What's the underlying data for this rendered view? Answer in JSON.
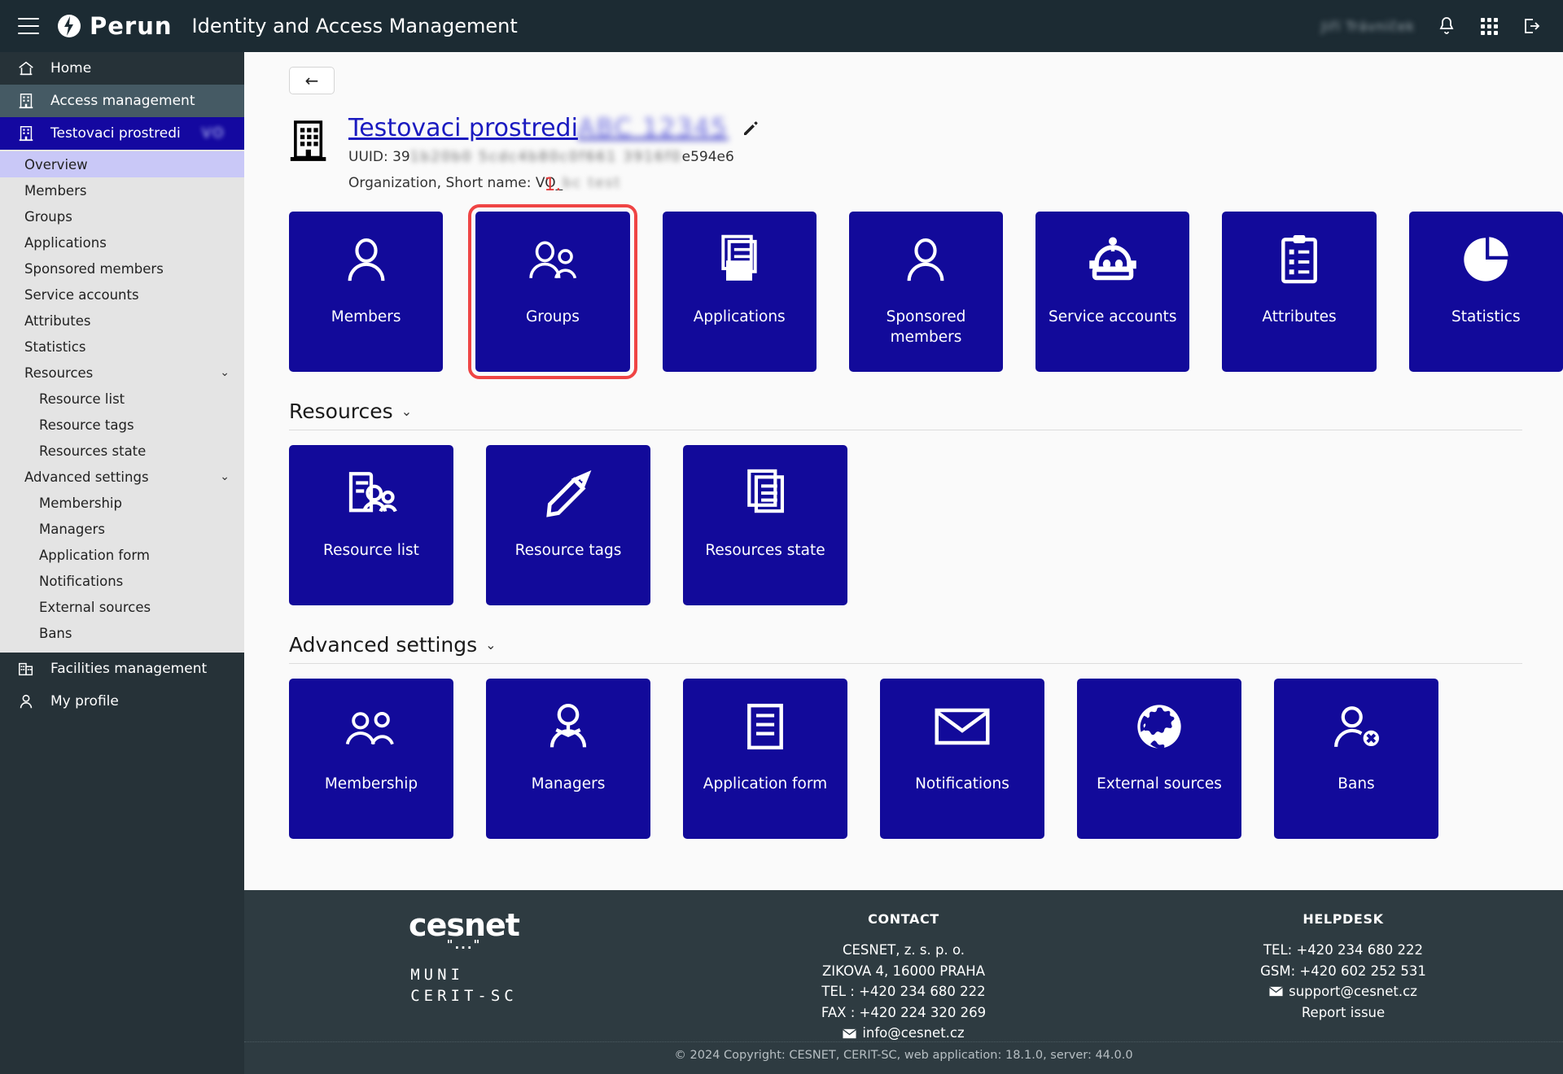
{
  "topbar": {
    "app_name": "Perun",
    "app_title": "Identity and Access Management",
    "user_blurred": "Jiří Trávníček",
    "icons": {
      "menu": "hamburger-icon",
      "notifications": "bell-icon",
      "apps": "apps-grid-icon",
      "logout": "logout-icon"
    }
  },
  "sidebar": {
    "top_items": [
      {
        "label": "Home",
        "icon": "home-icon",
        "state": "normal"
      },
      {
        "label": "Access management",
        "icon": "building-icon",
        "state": "hover"
      },
      {
        "label": "Testovaci prostredi",
        "icon": "building-icon",
        "state": "active",
        "blurred_suffix": "VO"
      }
    ],
    "sub_items": [
      {
        "label": "Overview",
        "selected": true,
        "indent": false
      },
      {
        "label": "Members",
        "selected": false,
        "indent": false
      },
      {
        "label": "Groups",
        "selected": false,
        "indent": false
      },
      {
        "label": "Applications",
        "selected": false,
        "indent": false
      },
      {
        "label": "Sponsored members",
        "selected": false,
        "indent": false
      },
      {
        "label": "Service accounts",
        "selected": false,
        "indent": false
      },
      {
        "label": "Attributes",
        "selected": false,
        "indent": false
      },
      {
        "label": "Statistics",
        "selected": false,
        "indent": false
      },
      {
        "label": "Resources",
        "selected": false,
        "indent": false,
        "expandable": true
      },
      {
        "label": "Resource list",
        "selected": false,
        "indent": true
      },
      {
        "label": "Resource tags",
        "selected": false,
        "indent": true
      },
      {
        "label": "Resources state",
        "selected": false,
        "indent": true
      },
      {
        "label": "Advanced settings",
        "selected": false,
        "indent": false,
        "expandable": true
      },
      {
        "label": "Membership",
        "selected": false,
        "indent": true
      },
      {
        "label": "Managers",
        "selected": false,
        "indent": true
      },
      {
        "label": "Application form",
        "selected": false,
        "indent": true
      },
      {
        "label": "Notifications",
        "selected": false,
        "indent": true
      },
      {
        "label": "External sources",
        "selected": false,
        "indent": true
      },
      {
        "label": "Bans",
        "selected": false,
        "indent": true
      }
    ],
    "bottom_items": [
      {
        "label": "Facilities management",
        "icon": "facility-icon"
      },
      {
        "label": "My profile",
        "icon": "person-icon"
      }
    ]
  },
  "main": {
    "back_button": "←",
    "org": {
      "name": "Testovaci prostredi",
      "name_blurred_suffix": "ABC 12345",
      "uuid_label": "UUID: 39",
      "uuid_blurred": "1b20b0 5cdc4b80c0f661 3916f0",
      "uuid_tail": "e594e6",
      "meta_label": "Organization, Short name: VO_",
      "meta_blurred": "bc test"
    },
    "step_annotation": "1.",
    "primary_tiles": [
      {
        "label": "Members",
        "icon": "person-icon"
      },
      {
        "label": "Groups",
        "icon": "people-icon",
        "highlighted": true
      },
      {
        "label": "Applications",
        "icon": "applications-icon"
      },
      {
        "label": "Sponsored members",
        "icon": "person-icon"
      },
      {
        "label": "Service accounts",
        "icon": "robot-icon"
      },
      {
        "label": "Attributes",
        "icon": "attributes-icon"
      },
      {
        "label": "Statistics",
        "icon": "pie-chart-icon"
      }
    ],
    "resources_section": {
      "title": "Resources",
      "tiles": [
        {
          "label": "Resource list",
          "icon": "resource-list-icon"
        },
        {
          "label": "Resource tags",
          "icon": "pencil-tag-icon"
        },
        {
          "label": "Resources state",
          "icon": "resources-state-icon"
        }
      ]
    },
    "advanced_section": {
      "title": "Advanced settings",
      "tiles": [
        {
          "label": "Membership",
          "icon": "people-icon"
        },
        {
          "label": "Managers",
          "icon": "manager-icon"
        },
        {
          "label": "Application form",
          "icon": "form-icon"
        },
        {
          "label": "Notifications",
          "icon": "envelope-icon"
        },
        {
          "label": "External sources",
          "icon": "globe-icon"
        },
        {
          "label": "Bans",
          "icon": "person-ban-icon"
        }
      ]
    }
  },
  "footer": {
    "logo_text": "cesnet",
    "logo_dots": "\"...\"",
    "muni_line1": "MUNI",
    "muni_line2": "CERIT-SC",
    "contact": {
      "heading": "CONTACT",
      "lines": [
        "CESNET, z. s. p. o.",
        "ZIKOVA 4, 16000 PRAHA",
        "TEL : +420 234 680 222",
        "FAX : +420 224 320 269"
      ],
      "email": "info@cesnet.cz"
    },
    "helpdesk": {
      "heading": "HELPDESK",
      "lines": [
        "TEL: +420 234 680 222",
        "GSM: +420 602 252 531"
      ],
      "email": "support@cesnet.cz",
      "report": "Report issue"
    },
    "copyright": "© 2024 Copyright: CESNET, CERIT-SC, web application: 18.1.0, server: 44.0.0"
  },
  "colors": {
    "tile_blue": "#120a9a",
    "topbar": "#1c2b33",
    "sidebar": "#263238",
    "active_blue": "#1408a0",
    "highlight_red": "#ef4444"
  }
}
